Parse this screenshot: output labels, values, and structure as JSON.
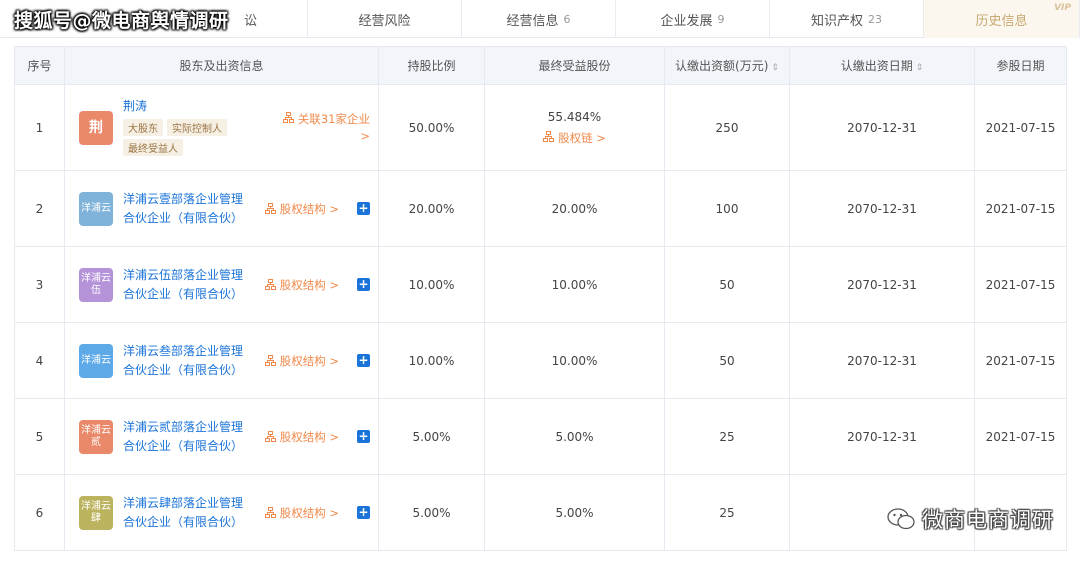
{
  "overlay": {
    "title": "搜狐号@微电商舆情调研",
    "watermark": "微商电商调研",
    "watermark_icon": "wechat-icon"
  },
  "tabs": [
    {
      "label": "讼",
      "count": ""
    },
    {
      "label": "经营风险",
      "count": ""
    },
    {
      "label": "经营信息",
      "count": "6"
    },
    {
      "label": "企业发展",
      "count": "9"
    },
    {
      "label": "知识产权",
      "count": "23"
    },
    {
      "label": "历史信息",
      "count": "",
      "badge": "VIP"
    }
  ],
  "table": {
    "headers": {
      "index": "序号",
      "holder": "股东及出资信息",
      "ratio": "持股比例",
      "final_share": "最终受益股份",
      "subscribed_amount": "认缴出资额(万元)",
      "subscribed_date": "认缴出资日期",
      "join_date": "参股日期"
    },
    "rows": [
      {
        "index": "1",
        "logo_text": "荆",
        "logo_color": "#e9896a",
        "name": "荆涛",
        "tags": [
          "大股东",
          "实际控制人",
          "最终受益人"
        ],
        "side_link": "关联31家企业 >",
        "ratio": "50.00%",
        "final_share": "55.484%",
        "final_share_link": "股权链 >",
        "amount": "250",
        "sub_date": "2070-12-31",
        "join_date": "2021-07-15"
      },
      {
        "index": "2",
        "logo_text": "洋浦云",
        "logo_color": "#7fb3d9",
        "name": "洋浦云壹部落企业管理合伙企业（有限合伙）",
        "tags": [],
        "side_link": "股权结构 >",
        "ratio": "20.00%",
        "final_share": "20.00%",
        "final_share_link": "",
        "amount": "100",
        "sub_date": "2070-12-31",
        "join_date": "2021-07-15"
      },
      {
        "index": "3",
        "logo_text": "洋浦云伍",
        "logo_color": "#b493d9",
        "name": "洋浦云伍部落企业管理合伙企业（有限合伙）",
        "tags": [],
        "side_link": "股权结构 >",
        "ratio": "10.00%",
        "final_share": "10.00%",
        "final_share_link": "",
        "amount": "50",
        "sub_date": "2070-12-31",
        "join_date": "2021-07-15"
      },
      {
        "index": "4",
        "logo_text": "洋浦云",
        "logo_color": "#5ea9e8",
        "name": "洋浦云叁部落企业管理合伙企业（有限合伙）",
        "tags": [],
        "side_link": "股权结构 >",
        "ratio": "10.00%",
        "final_share": "10.00%",
        "final_share_link": "",
        "amount": "50",
        "sub_date": "2070-12-31",
        "join_date": "2021-07-15"
      },
      {
        "index": "5",
        "logo_text": "洋浦云贰",
        "logo_color": "#e9896a",
        "name": "洋浦云贰部落企业管理合伙企业（有限合伙）",
        "tags": [],
        "side_link": "股权结构 >",
        "ratio": "5.00%",
        "final_share": "5.00%",
        "final_share_link": "",
        "amount": "25",
        "sub_date": "2070-12-31",
        "join_date": "2021-07-15"
      },
      {
        "index": "6",
        "logo_text": "洋浦云肆",
        "logo_color": "#bcb35f",
        "name": "洋浦云肆部落企业管理合伙企业（有限合伙）",
        "tags": [],
        "side_link": "股权结构 >",
        "ratio": "5.00%",
        "final_share": "5.00%",
        "final_share_link": "",
        "amount": "25",
        "sub_date": "",
        "join_date": ""
      }
    ]
  }
}
